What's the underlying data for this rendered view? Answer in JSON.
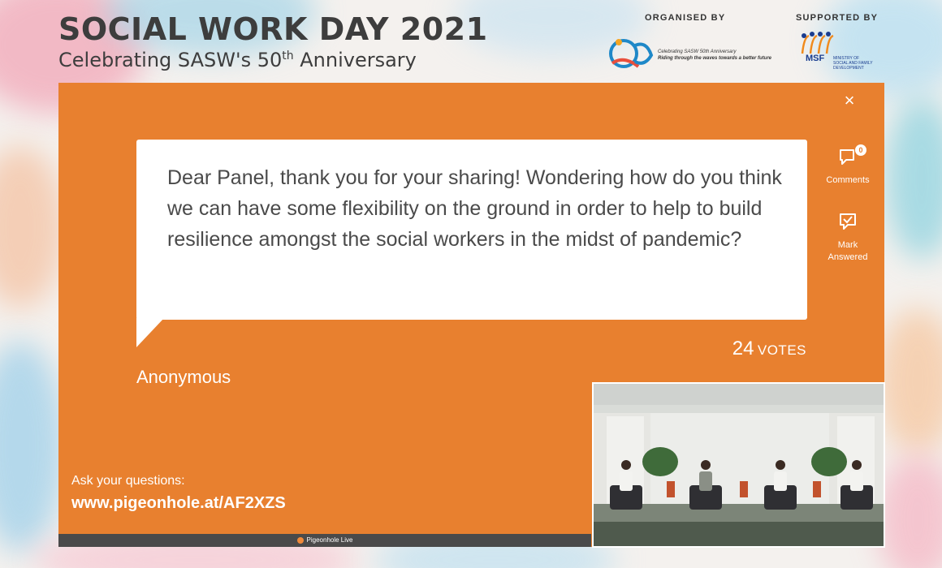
{
  "header": {
    "title": "SOCIAL WORK DAY 2021",
    "subtitle_main": "Celebrating SASW's 50",
    "subtitle_sup": "th",
    "subtitle_end": " Anniversary",
    "organised_label": "ORGANISED BY",
    "supported_label": "SUPPORTED BY",
    "sasw_logo_text_1": "Celebrating SASW 50th Anniversary",
    "sasw_logo_text_2": "Riding through the waves towards a better future",
    "msf_mark": "MSF",
    "msf_text_1": "MINISTRY OF",
    "msf_text_2": "SOCIAL AND FAMILY",
    "msf_text_3": "DEVELOPMENT"
  },
  "panel": {
    "close_icon": "×",
    "question": "Dear Panel, thank you for your sharing! Wondering how do you think we can have some flexibility on the ground in order to help to build resilience amongst the social workers in the midst of pandemic?",
    "votes_count": "24",
    "votes_label": "VOTES",
    "author": "Anonymous",
    "comments_label": "Comments",
    "comments_count": "0",
    "mark_answered_label_1": "Mark",
    "mark_answered_label_2": "Answered",
    "ask_label": "Ask your questions:",
    "ask_url": "www.pigeonhole.at/AF2XZS",
    "footer_brand": "Pigeonhole Live"
  },
  "colors": {
    "panel_orange": "#e8802f",
    "footer_gray": "#4a4a4a",
    "title_gray": "#3d3d3d"
  },
  "icons": [
    "close-icon",
    "comment-icon",
    "mark-answered-icon",
    "pigeonhole-logo-icon"
  ]
}
